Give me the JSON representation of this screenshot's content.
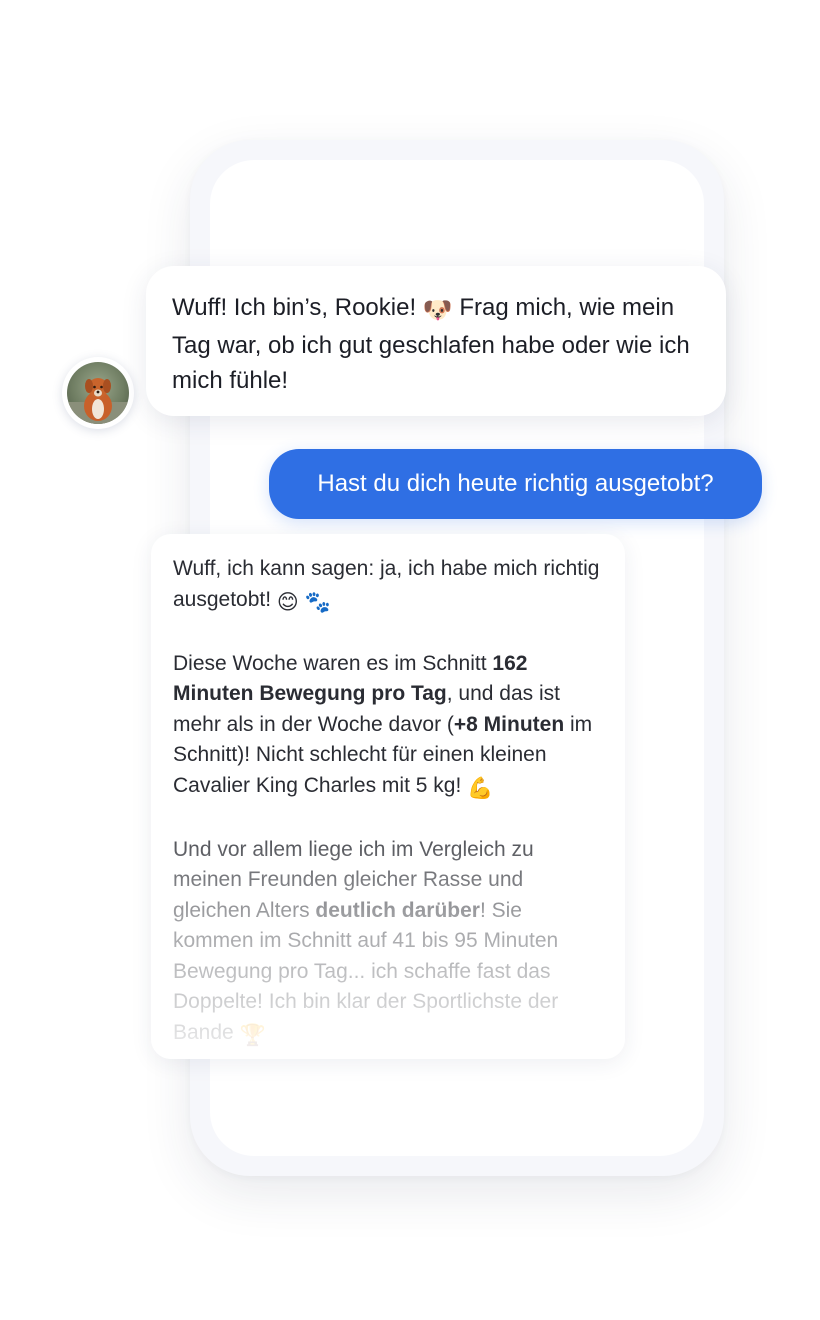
{
  "intro_message": {
    "text_part1": "Wuff! Ich bin’s, Rookie! ",
    "emoji": "🐶",
    "text_part2": " Frag mich, wie mein Tag war, ob ich gut geschlafen habe oder wie ich mich fühle!"
  },
  "user_message": {
    "text": "Hast du dich heute richtig ausgetobt?"
  },
  "reply_message": {
    "p1_text": "Wuff, ich kann sagen: ja, ich habe mich richtig ausgetobt! ",
    "p1_emoji_1": "😊",
    "p1_emoji_2": "🐾",
    "p2_a": "Diese Woche waren es im Schnitt ",
    "p2_b": "162 Minuten Bewegung pro Tag",
    "p2_c": ", und das ist mehr als in der Woche davor (",
    "p2_d": "+8 Minuten",
    "p2_e": " im Schnitt)! Nicht schlecht für einen kleinen Cavalier King Charles mit 5 kg! ",
    "p2_emoji": "💪",
    "p3_a": "Und vor allem liege ich im Vergleich zu meinen Freunden gleicher Rasse und gleichen Alters ",
    "p3_b": "deutlich darüber",
    "p3_c": "! Sie kommen im Schnitt auf 41 bis 95 Minuten Bewegung pro Tag... ich schaffe fast das Doppelte! Ich bin klar der Sportlichste der Bande ",
    "p3_emoji": "🏆"
  },
  "icons": {
    "avatar": "dog-avatar-icon"
  }
}
